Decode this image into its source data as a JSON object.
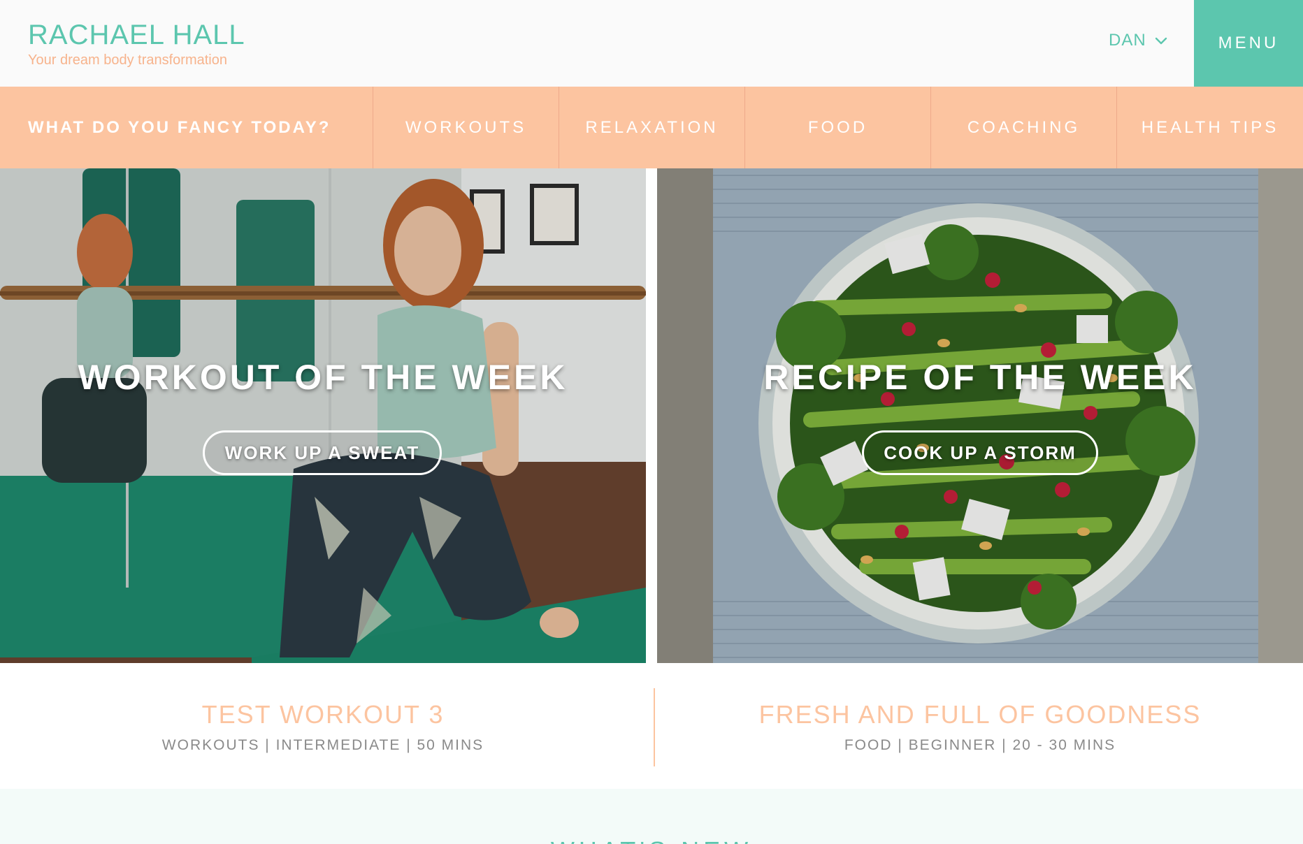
{
  "header": {
    "brand_name": "RACHAEL HALL",
    "brand_tagline": "Your dream body transformation",
    "user_name": "DAN",
    "menu_label": "MENU"
  },
  "nav": {
    "lead": "WHAT DO YOU FANCY TODAY?",
    "items": [
      "WORKOUTS",
      "RELAXATION",
      "FOOD",
      "COACHING",
      "HEALTH TIPS"
    ]
  },
  "features": {
    "workout": {
      "title": "WORKOUT OF THE WEEK",
      "cta": "WORK UP A SWEAT",
      "caption_title": "TEST WORKOUT 3",
      "caption_meta": "WORKOUTS | INTERMEDIATE | 50 MINS"
    },
    "recipe": {
      "title": "RECIPE OF THE WEEK",
      "cta": "COOK UP A STORM",
      "caption_title": "FRESH AND FULL OF GOODNESS",
      "caption_meta": "FOOD | BEGINNER | 20 - 30 MINS"
    }
  },
  "whatsnew": {
    "title": "WHAT'S NEW"
  },
  "colors": {
    "teal": "#5cc6ae",
    "peach": "#fcc4a0",
    "peach_text": "#f7b38c",
    "meta_gray": "#8a8a8a"
  }
}
